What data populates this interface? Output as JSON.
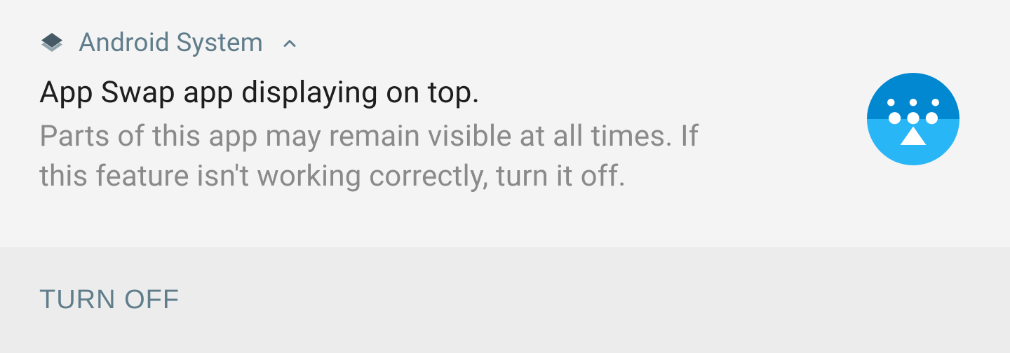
{
  "header": {
    "app_label": "Android System"
  },
  "notification": {
    "title": "App Swap app displaying on top.",
    "body": "Parts of this app may remain visible at all times. If this feature isn't working correctly, turn it off."
  },
  "actions": {
    "turn_off": "TURN OFF"
  },
  "colors": {
    "accent": "#607d8b",
    "icon_top": "#0288d1",
    "icon_bottom": "#29b6f6"
  }
}
